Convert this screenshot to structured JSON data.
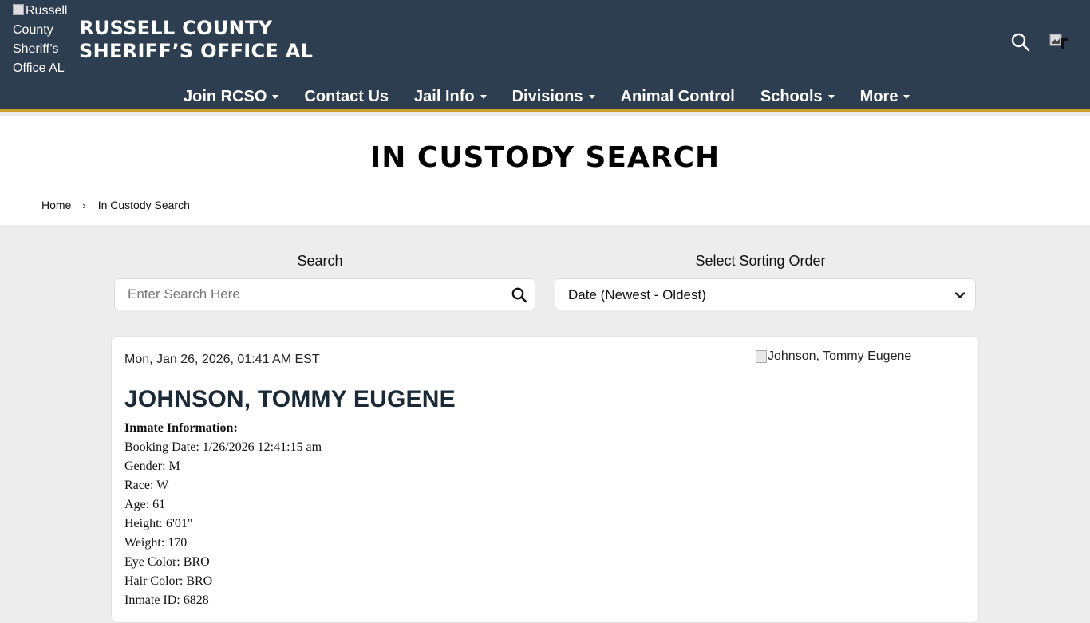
{
  "header": {
    "logo_alt": "Russell County Sheriff’s Office AL",
    "title_line1": "RUSSELL COUNTY",
    "title_line2": "SHERIFF’S OFFICE AL",
    "search_icon": "search-icon",
    "flag_icon": "broken-image-icon"
  },
  "nav": {
    "items": [
      {
        "label": "Join RCSO",
        "dropdown": true
      },
      {
        "label": "Contact Us",
        "dropdown": false
      },
      {
        "label": "Jail Info",
        "dropdown": true
      },
      {
        "label": "Divisions",
        "dropdown": true
      },
      {
        "label": "Animal Control",
        "dropdown": false
      },
      {
        "label": "Schools",
        "dropdown": true
      },
      {
        "label": "More",
        "dropdown": true
      }
    ]
  },
  "page": {
    "title": "IN CUSTODY SEARCH",
    "breadcrumb_home": "Home",
    "breadcrumb_sep": "›",
    "breadcrumb_current": "In Custody Search"
  },
  "search": {
    "label": "Search",
    "placeholder": "Enter Search Here",
    "value": ""
  },
  "sort": {
    "label": "Select Sorting Order",
    "selected": "Date (Newest - Oldest)"
  },
  "inmate": {
    "date": "Mon, Jan 26, 2026, 01:41 AM EST",
    "photo_alt": "Johnson, Tommy Eugene",
    "name": "JOHNSON, TOMMY EUGENE",
    "info_heading": "Inmate Information:",
    "booking_date": "Booking Date: 1/26/2026 12:41:15 am",
    "gender": "Gender: M",
    "race": "Race: W",
    "age": "Age: 61",
    "height": "Height: 6'01\"",
    "weight": "Weight: 170",
    "eye_color": "Eye Color: BRO",
    "hair_color": "Hair Color: BRO",
    "inmate_id": "Inmate ID: 6828"
  },
  "colors": {
    "header_bg": "#2d3e50",
    "accent_gold": "#c9a227",
    "page_bg": "#ededed"
  }
}
